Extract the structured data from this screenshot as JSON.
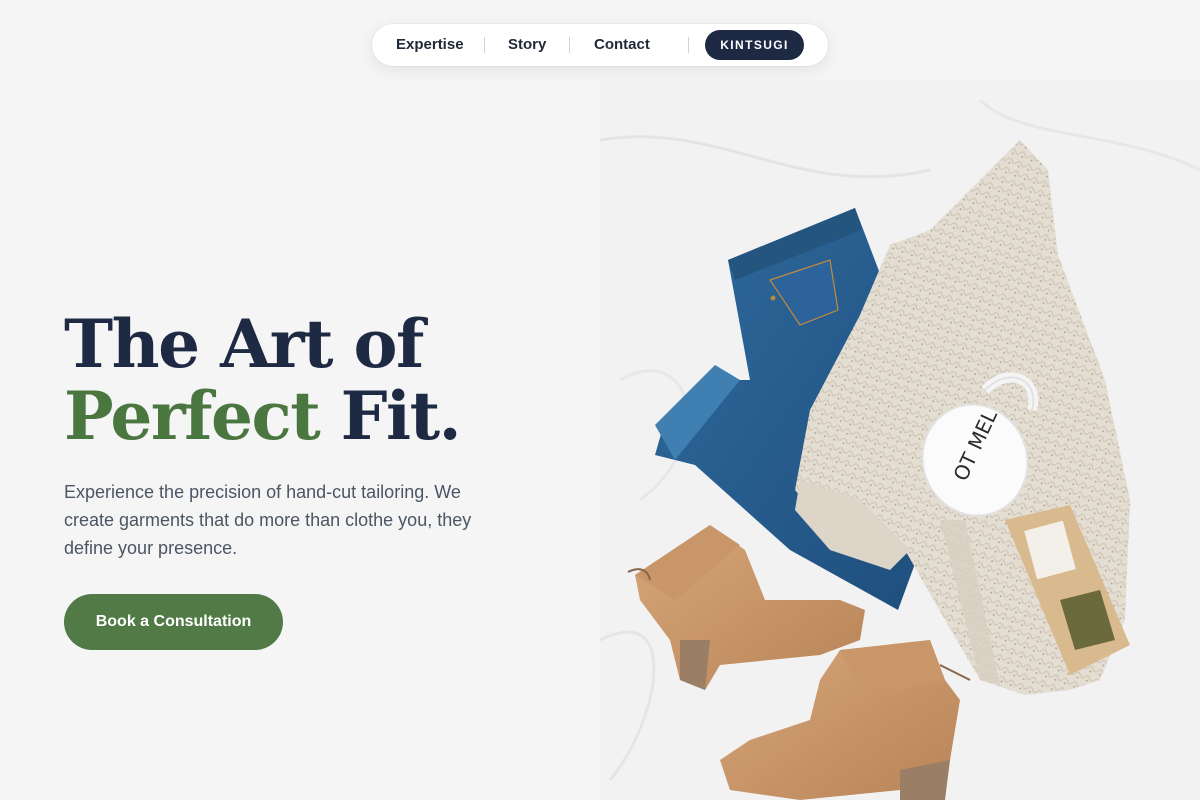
{
  "nav": {
    "links": [
      {
        "label": "Expertise"
      },
      {
        "label": "Story"
      },
      {
        "label": "Contact"
      }
    ],
    "brand_label": "KINTSUGI"
  },
  "hero": {
    "headline_line1": "The Art of",
    "headline_accent": "Perfect",
    "headline_rest": " Fit.",
    "description": "Experience the precision of hand-cut tailoring. We create garments that do more than clothe you, they define your presence.",
    "cta_label": "Book a Consultation",
    "image": {
      "mug_text": "OT MEL",
      "alt_subject": "flat-lay of jeans, knit cardigan, mug, tea bag and suede ankle boots"
    }
  },
  "colors": {
    "background": "#f5f5f5",
    "navy": "#1e2a44",
    "accent_green": "#4a7640",
    "button_green": "#527a46",
    "body_text": "#4b5563"
  }
}
